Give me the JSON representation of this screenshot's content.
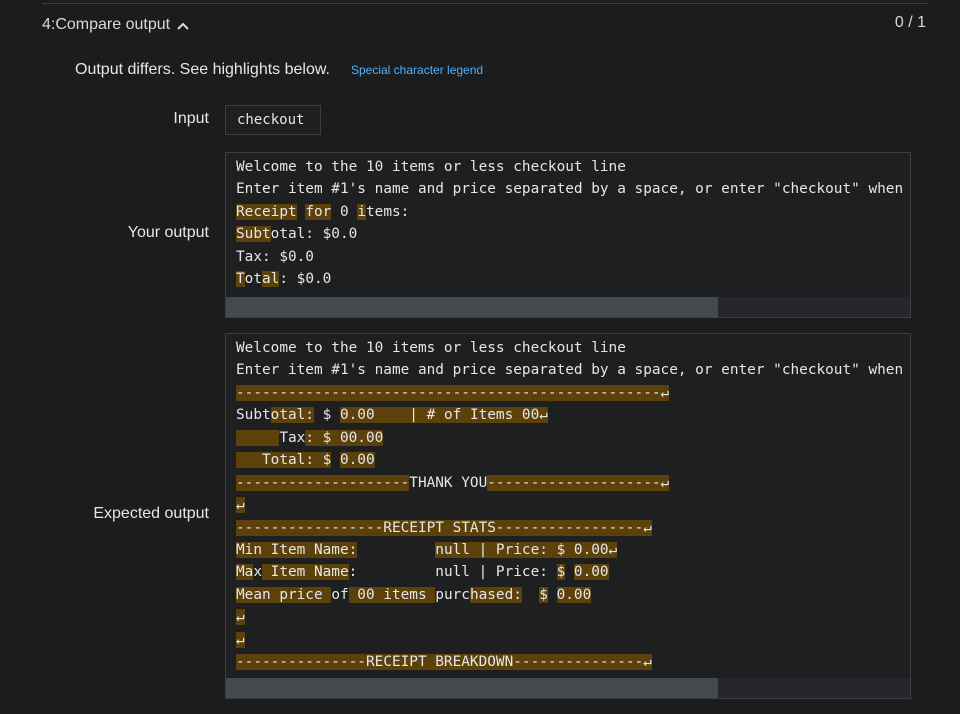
{
  "header": {
    "test_title": "4:Compare output",
    "chevron_icon": "chevron-up-icon",
    "score": "0 / 1"
  },
  "status": {
    "message": "Output differs. See highlights below.",
    "legend_link": "Special character legend"
  },
  "input": {
    "label": "Input",
    "value": "checkout"
  },
  "your_output": {
    "label": "Your output",
    "lines": [
      [
        {
          "t": "Welcome to the 10 items or less checkout line"
        }
      ],
      [
        {
          "t": "Enter item #1's name and price separated by a space, or enter \"checkout\" when you are done:"
        }
      ],
      [
        {
          "t": "Receipt",
          "h": true
        },
        {
          "t": " "
        },
        {
          "t": "for",
          "h": true
        },
        {
          "t": " 0 "
        },
        {
          "t": "i",
          "h": true
        },
        {
          "t": "tems:"
        }
      ],
      [
        {
          "t": "Subt",
          "h": true
        },
        {
          "t": "otal: $0.0"
        }
      ],
      [
        {
          "t": "Tax: $0.0"
        }
      ],
      [
        {
          "t": "T",
          "h": true
        },
        {
          "t": "ot"
        },
        {
          "t": "al",
          "h": true
        },
        {
          "t": ": $0.0"
        }
      ]
    ],
    "scrollbar_fraction": 0.72
  },
  "expected_output": {
    "label": "Expected output",
    "lines": [
      [
        {
          "t": "Welcome to the 10 items or less checkout line"
        }
      ],
      [
        {
          "t": "Enter item #1's name and price separated by a space, or enter \"checkout\" when you are done:"
        }
      ],
      [
        {
          "t": "-------------------------------------------------↵",
          "h": true
        }
      ],
      [
        {
          "t": "Subt"
        },
        {
          "t": "otal:",
          "h": true
        },
        {
          "t": " $ "
        },
        {
          "t": "0.00",
          "h": true
        },
        {
          "t": "    | # of Items 00↵",
          "h": true
        }
      ],
      [
        {
          "t": "     ",
          "h": true
        },
        {
          "t": "Tax"
        },
        {
          "t": ": $ 00.00",
          "h": true
        }
      ],
      [
        {
          "t": "   ",
          "h": true
        },
        {
          "t": "Total: $",
          "h": true
        },
        {
          "t": " "
        },
        {
          "t": "0.00",
          "h": true
        }
      ],
      [
        {
          "t": "--------------------",
          "h": true
        },
        {
          "t": "THANK YOU"
        },
        {
          "t": "--------------------↵",
          "h": true
        }
      ],
      [
        {
          "t": "↵",
          "h": true
        }
      ],
      [
        {
          "t": "-----------------RECEIPT STATS-----------------↵",
          "h": true
        }
      ],
      [
        {
          "t": "Min Item Name:",
          "h": true
        },
        {
          "t": "         "
        },
        {
          "t": "null | Price: $ 0.00↵",
          "h": true
        }
      ],
      [
        {
          "t": "Ma",
          "h": true
        },
        {
          "t": "x"
        },
        {
          "t": " Item Name",
          "h": true
        },
        {
          "t": ":         null | Price: "
        },
        {
          "t": "$",
          "h": true
        },
        {
          "t": " "
        },
        {
          "t": "0.00",
          "h": true
        }
      ],
      [
        {
          "t": "Mean price ",
          "h": true
        },
        {
          "t": "of"
        },
        {
          "t": " 00 items ",
          "h": true
        },
        {
          "t": "purc"
        },
        {
          "t": "hased:",
          "h": true
        },
        {
          "t": "  "
        },
        {
          "t": "$",
          "h": true
        },
        {
          "t": " "
        },
        {
          "t": "0.00",
          "h": true
        }
      ],
      [
        {
          "t": "↵",
          "h": true
        }
      ],
      [
        {
          "t": "↵",
          "h": true
        }
      ],
      [
        {
          "t": "---------------RECEIPT BREAKDOWN---------------↵",
          "h": true
        }
      ]
    ],
    "scrollbar_fraction": 0.72
  },
  "colors": {
    "highlight": "#5c420a",
    "link": "#4fb1ff"
  }
}
